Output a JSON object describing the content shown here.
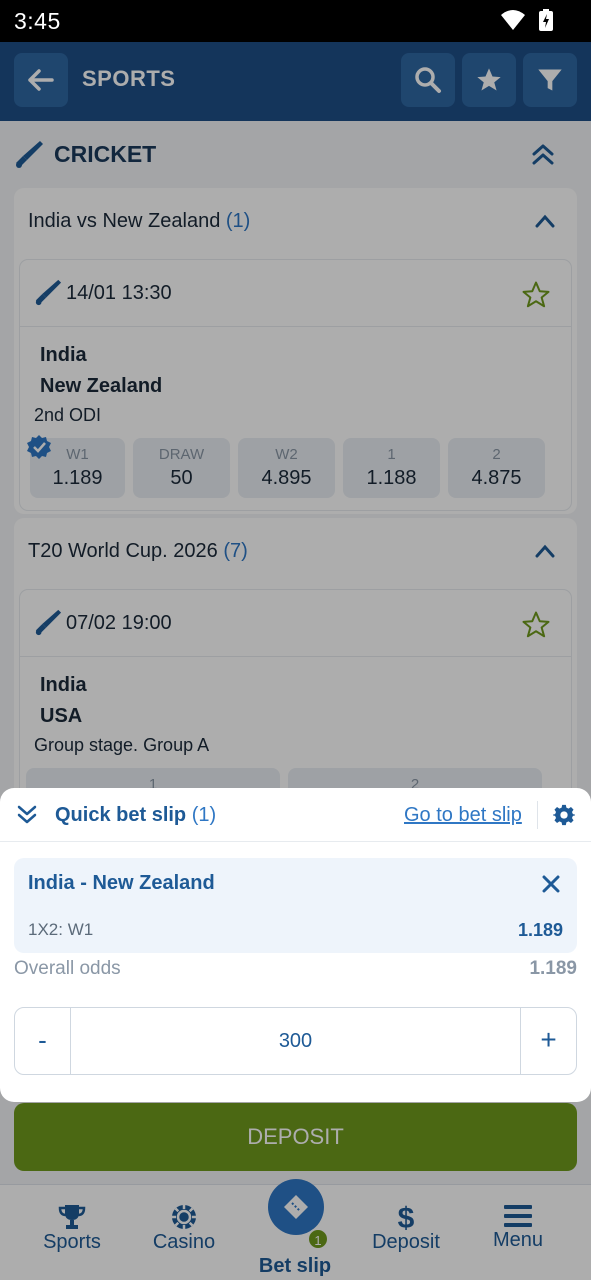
{
  "status": {
    "time": "3:45"
  },
  "header": {
    "title": "SPORTS"
  },
  "sport": {
    "title": "CRICKET"
  },
  "groups": [
    {
      "name": "India vs New Zealand",
      "count": "(1)",
      "event": {
        "datetime": "14/01 13:30",
        "team1": "India",
        "team2": "New Zealand",
        "stage": "2nd ODI",
        "odds": [
          {
            "label": "W1",
            "value": "1.189"
          },
          {
            "label": "DRAW",
            "value": "50"
          },
          {
            "label": "W2",
            "value": "4.895"
          },
          {
            "label": "1",
            "value": "1.188"
          },
          {
            "label": "2",
            "value": "4.875"
          }
        ]
      }
    },
    {
      "name": "T20 World Cup. 2026",
      "count": "(7)",
      "event": {
        "datetime": "07/02 19:00",
        "team1": "India",
        "team2": "USA",
        "stage": "Group stage. Group A",
        "odds": [
          {
            "label": "1"
          },
          {
            "label": "2"
          }
        ]
      }
    }
  ],
  "quick_slip": {
    "title": "Quick bet slip",
    "count": "(1)",
    "go_link": "Go to bet slip",
    "bet": {
      "match": "India - New Zealand",
      "market": "1X2: W1",
      "odds": "1.189"
    },
    "overall_label": "Overall odds",
    "overall_value": "1.189",
    "stake": {
      "minus": "-",
      "value": "300",
      "plus": "+"
    }
  },
  "deposit_button": "DEPOSIT",
  "bottom_nav": {
    "items": [
      {
        "label": "Sports",
        "icon": "trophy-icon"
      },
      {
        "label": "Casino",
        "icon": "casino-chip-icon"
      },
      {
        "label": "Bet slip",
        "icon": "ticket-icon",
        "badge": "1"
      },
      {
        "label": "Deposit",
        "icon": "dollar-icon"
      },
      {
        "label": "Menu",
        "icon": "hamburger-icon"
      }
    ]
  },
  "colors": {
    "header": "#1e4f86",
    "accent": "#2f77c4",
    "deposit": "#6f9a1d"
  }
}
